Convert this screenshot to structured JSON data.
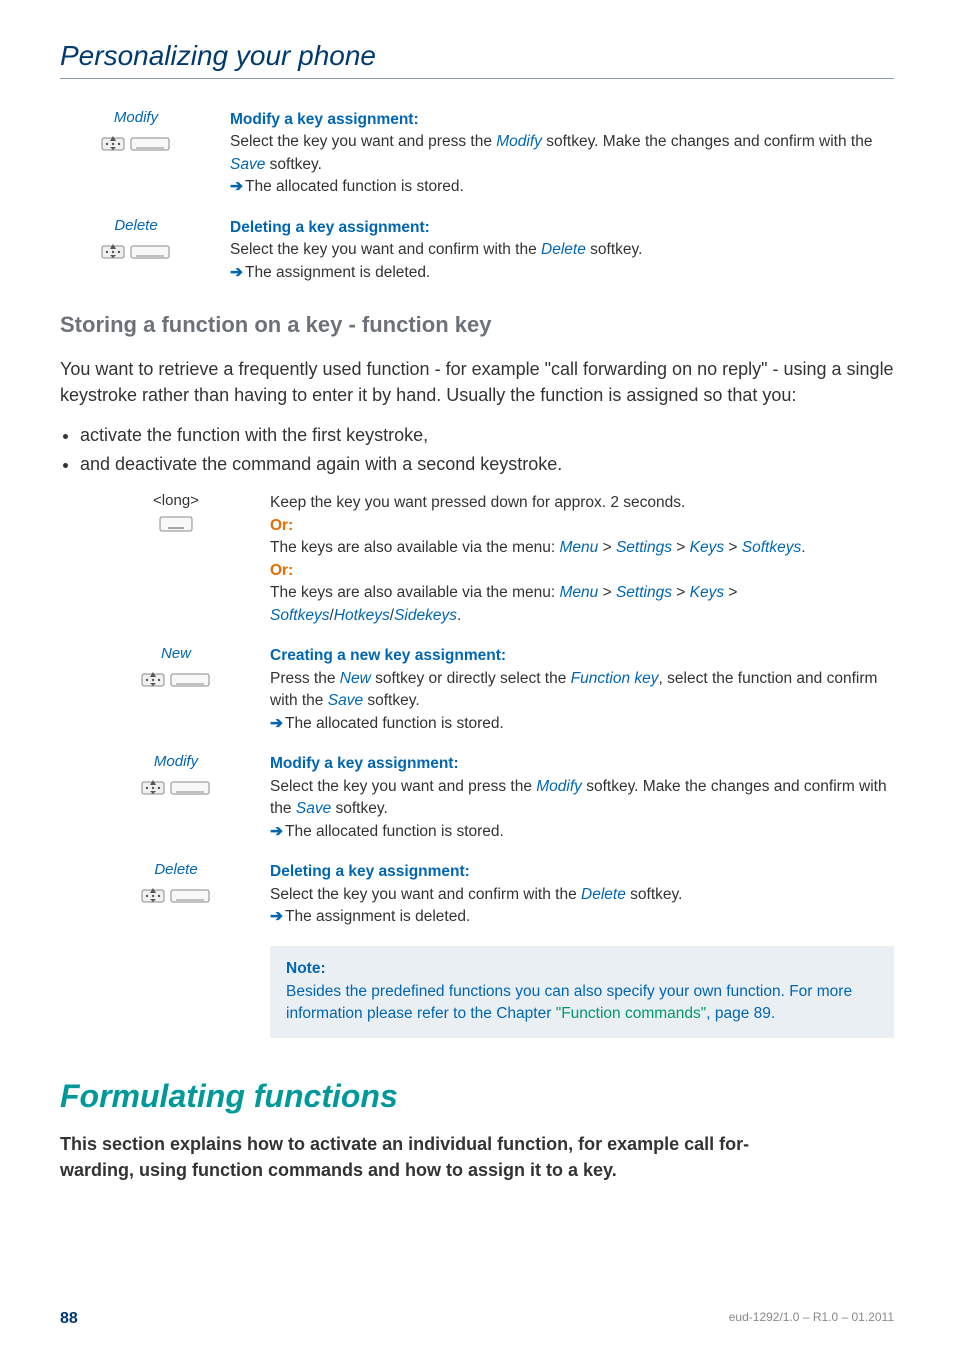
{
  "header": {
    "title": "Personalizing your phone"
  },
  "top_steps": [
    {
      "label": "Modify",
      "icon": "softkey",
      "heading": "Modify a key assignment:",
      "lines": [
        {
          "segments": [
            {
              "t": "Select the key you want and press the "
            },
            {
              "t": "Modify",
              "cls": "italic-blue"
            },
            {
              "t": " softkey. Make the changes and confirm with the "
            },
            {
              "t": "Save",
              "cls": "italic-blue"
            },
            {
              "t": " softkey."
            }
          ]
        },
        {
          "arrow": true,
          "segments": [
            {
              "t": "The allocated function is stored."
            }
          ]
        }
      ]
    },
    {
      "label": "Delete",
      "icon": "softkey",
      "heading": "Deleting a key assignment:",
      "lines": [
        {
          "segments": [
            {
              "t": "Select the key you want and confirm with the "
            },
            {
              "t": "Delete",
              "cls": "italic-blue"
            },
            {
              "t": " softkey."
            }
          ]
        },
        {
          "arrow": true,
          "segments": [
            {
              "t": "The assignment is deleted."
            }
          ]
        }
      ]
    }
  ],
  "section_heading": "Storing a function on a key - function key",
  "section_para": "You want to retrieve  a frequently used function - for example \"call forwarding on no reply\" - using a single keystroke rather than having to enter it by hand. Usually the function is assigned so that you:",
  "bullets": [
    "activate the function with the first keystroke,",
    "and deactivate the command again with a second keystroke."
  ],
  "lower_steps": [
    {
      "label": "<long>",
      "icon": "longkey",
      "label_style": "plain",
      "heading": "",
      "lines": [
        {
          "segments": [
            {
              "t": "Keep the key you want pressed down for approx. 2 seconds."
            }
          ]
        },
        {
          "segments": [
            {
              "t": "Or:",
              "cls": "orange-bold"
            }
          ]
        },
        {
          "segments": [
            {
              "t": "The keys are also available via the menu: "
            },
            {
              "t": "Menu",
              "cls": "italic-blue"
            },
            {
              "t": " > "
            },
            {
              "t": "Settings",
              "cls": "italic-blue"
            },
            {
              "t": " > "
            },
            {
              "t": "Keys",
              "cls": "italic-blue"
            },
            {
              "t": " > "
            },
            {
              "t": "Softkeys",
              "cls": "italic-blue"
            },
            {
              "t": "."
            }
          ]
        },
        {
          "segments": [
            {
              "t": "Or:",
              "cls": "orange-bold"
            }
          ]
        },
        {
          "segments": [
            {
              "t": "The keys are also available via the menu: "
            },
            {
              "t": "Menu",
              "cls": "italic-blue"
            },
            {
              "t": " > "
            },
            {
              "t": "Settings",
              "cls": "italic-blue"
            },
            {
              "t": " > "
            },
            {
              "t": "Keys",
              "cls": "italic-blue"
            },
            {
              "t": " > "
            },
            {
              "t": "Softkeys",
              "cls": "italic-blue"
            },
            {
              "t": "/"
            },
            {
              "t": "Hotkeys",
              "cls": "italic-blue"
            },
            {
              "t": "/"
            },
            {
              "t": "Sidekeys",
              "cls": "italic-blue"
            },
            {
              "t": "."
            }
          ]
        }
      ]
    },
    {
      "label": "New",
      "icon": "softkey",
      "heading": "Creating a new key assignment:",
      "lines": [
        {
          "segments": [
            {
              "t": "Press the "
            },
            {
              "t": "New",
              "cls": "italic-blue"
            },
            {
              "t": " softkey or directly select the "
            },
            {
              "t": "Function key",
              "cls": "italic-blue"
            },
            {
              "t": ", select the function and confirm with the "
            },
            {
              "t": "Save",
              "cls": "italic-blue"
            },
            {
              "t": " softkey."
            }
          ]
        },
        {
          "arrow": true,
          "segments": [
            {
              "t": "The allocated function is stored."
            }
          ]
        }
      ]
    },
    {
      "label": "Modify",
      "icon": "softkey",
      "heading": "Modify a key assignment:",
      "lines": [
        {
          "segments": [
            {
              "t": "Select the key you want and press the "
            },
            {
              "t": "Modify",
              "cls": "italic-blue"
            },
            {
              "t": " softkey. Make the changes and confirm with the "
            },
            {
              "t": "Save",
              "cls": "italic-blue"
            },
            {
              "t": " softkey."
            }
          ]
        },
        {
          "arrow": true,
          "segments": [
            {
              "t": "The allocated function is stored."
            }
          ]
        }
      ]
    },
    {
      "label": "Delete",
      "icon": "softkey",
      "heading": "Deleting a key assignment:",
      "lines": [
        {
          "segments": [
            {
              "t": "Select the key you want and confirm with the "
            },
            {
              "t": "Delete",
              "cls": "italic-blue"
            },
            {
              "t": " softkey."
            }
          ]
        },
        {
          "arrow": true,
          "segments": [
            {
              "t": "The assignment is deleted."
            }
          ]
        }
      ]
    }
  ],
  "note": {
    "title": "Note:",
    "body_segments": [
      {
        "t": "Besides the predefined functions you can also specify your own function. For more information please refer to the Chapter ",
        "cls": "blue-note"
      },
      {
        "t": "\"Function commands\"",
        "cls": "quoted-green"
      },
      {
        "t": ", page ",
        "cls": "blue-note"
      },
      {
        "t": "89",
        "cls": "blue-note"
      },
      {
        "t": ".",
        "cls": "blue-note"
      }
    ]
  },
  "h1": "Formulating functions",
  "intro_lines": [
    "This section explains how to activate an individual function, for example call for-",
    "warding, using function commands and how to assign it to a key."
  ],
  "footer": {
    "page": "88",
    "doc_id": "eud-1292/1.0 – R1.0 – 01.2011"
  }
}
